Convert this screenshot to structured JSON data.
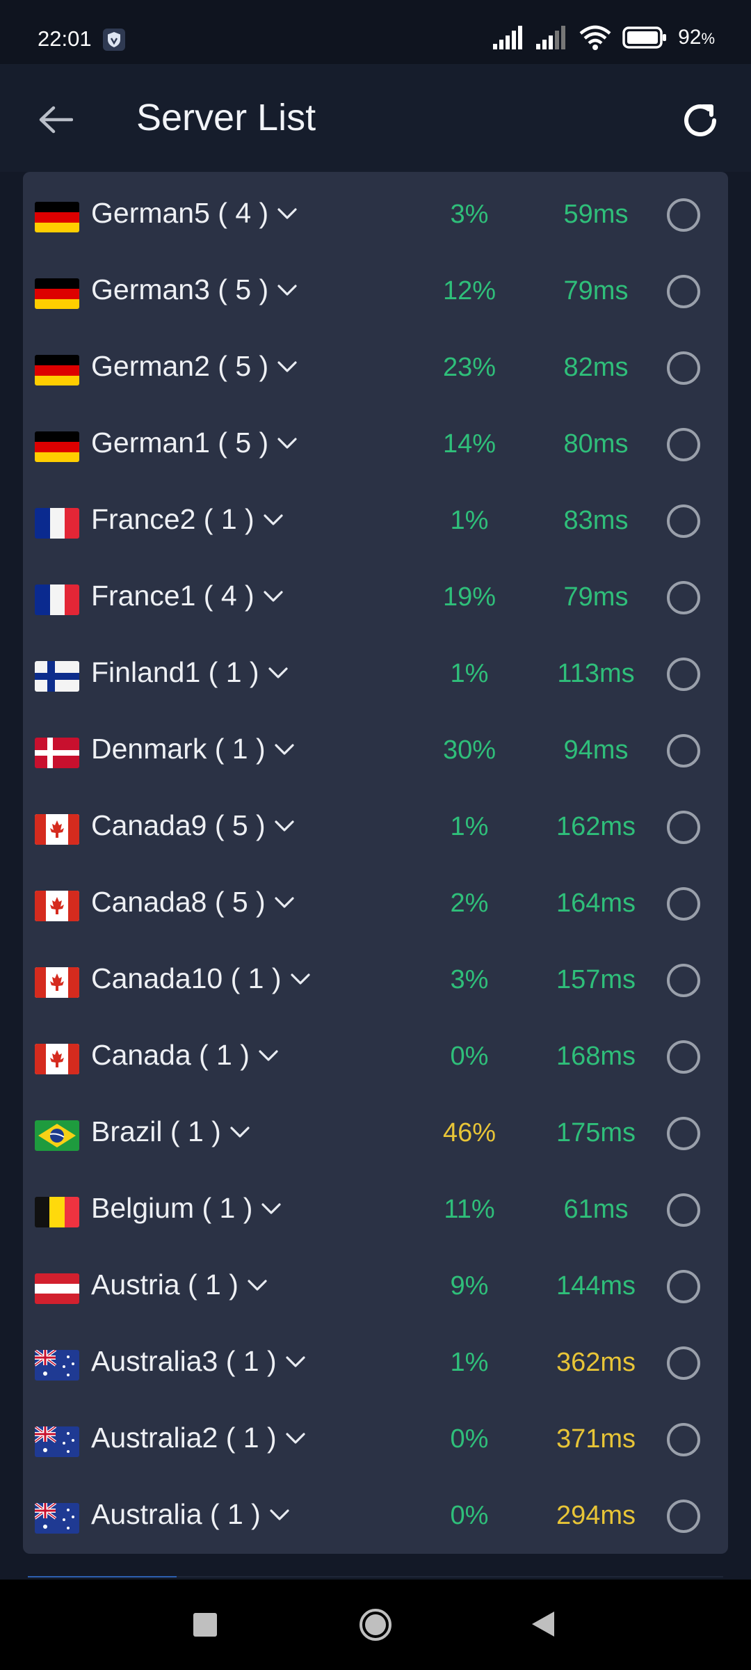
{
  "status_bar": {
    "time": "22:01",
    "battery": "92",
    "battery_unit": "%"
  },
  "header": {
    "title": "Server List",
    "back_icon": "arrow-left-icon",
    "refresh_icon": "refresh-icon"
  },
  "colors": {
    "good": "#2fbf7a",
    "warning": "#e8c537",
    "card": "#2b3245",
    "background": "#131927"
  },
  "servers": [
    {
      "flag": "de",
      "name": "German5 ( 4 )",
      "load": "3%",
      "load_level": "good",
      "ping": "59ms",
      "ping_level": "good"
    },
    {
      "flag": "de",
      "name": "German3 ( 5 )",
      "load": "12%",
      "load_level": "good",
      "ping": "79ms",
      "ping_level": "good"
    },
    {
      "flag": "de",
      "name": "German2 ( 5 )",
      "load": "23%",
      "load_level": "good",
      "ping": "82ms",
      "ping_level": "good"
    },
    {
      "flag": "de",
      "name": "German1 ( 5 )",
      "load": "14%",
      "load_level": "good",
      "ping": "80ms",
      "ping_level": "good"
    },
    {
      "flag": "fr",
      "name": "France2 ( 1 )",
      "load": "1%",
      "load_level": "good",
      "ping": "83ms",
      "ping_level": "good"
    },
    {
      "flag": "fr",
      "name": "France1 ( 4 )",
      "load": "19%",
      "load_level": "good",
      "ping": "79ms",
      "ping_level": "good"
    },
    {
      "flag": "fi",
      "name": "Finland1 ( 1 )",
      "load": "1%",
      "load_level": "good",
      "ping": "113ms",
      "ping_level": "good"
    },
    {
      "flag": "dk",
      "name": "Denmark ( 1 )",
      "load": "30%",
      "load_level": "good",
      "ping": "94ms",
      "ping_level": "good"
    },
    {
      "flag": "ca",
      "name": "Canada9 ( 5 )",
      "load": "1%",
      "load_level": "good",
      "ping": "162ms",
      "ping_level": "good"
    },
    {
      "flag": "ca",
      "name": "Canada8 ( 5 )",
      "load": "2%",
      "load_level": "good",
      "ping": "164ms",
      "ping_level": "good"
    },
    {
      "flag": "ca",
      "name": "Canada10 ( 1 )",
      "load": "3%",
      "load_level": "good",
      "ping": "157ms",
      "ping_level": "good"
    },
    {
      "flag": "ca",
      "name": "Canada ( 1 )",
      "load": "0%",
      "load_level": "good",
      "ping": "168ms",
      "ping_level": "good"
    },
    {
      "flag": "br",
      "name": "Brazil ( 1 )",
      "load": "46%",
      "load_level": "warning",
      "ping": "175ms",
      "ping_level": "good"
    },
    {
      "flag": "be",
      "name": "Belgium ( 1 )",
      "load": "11%",
      "load_level": "good",
      "ping": "61ms",
      "ping_level": "good"
    },
    {
      "flag": "at",
      "name": "Austria ( 1 )",
      "load": "9%",
      "load_level": "good",
      "ping": "144ms",
      "ping_level": "good"
    },
    {
      "flag": "au",
      "name": "Australia3 ( 1 )",
      "load": "1%",
      "load_level": "good",
      "ping": "362ms",
      "ping_level": "warning"
    },
    {
      "flag": "au",
      "name": "Australia2 ( 1 )",
      "load": "0%",
      "load_level": "good",
      "ping": "371ms",
      "ping_level": "warning"
    },
    {
      "flag": "au",
      "name": "Australia ( 1 )",
      "load": "0%",
      "load_level": "good",
      "ping": "294ms",
      "ping_level": "warning"
    }
  ],
  "nav": {
    "recent_icon": "square-icon",
    "home_icon": "circle-icon",
    "back_icon": "triangle-back-icon"
  }
}
